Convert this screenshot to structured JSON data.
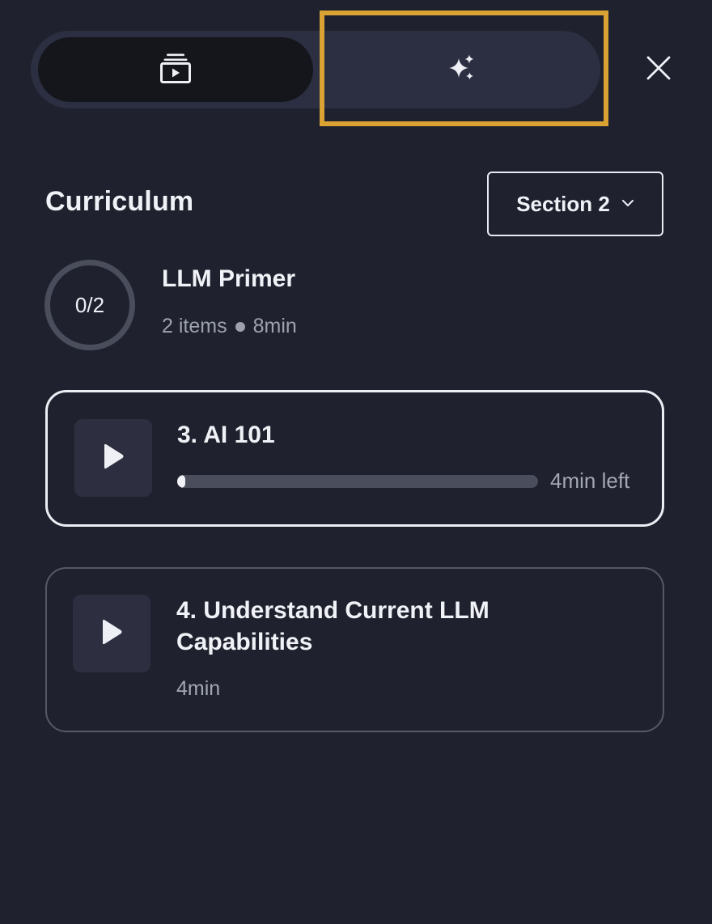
{
  "toggle": {
    "video_icon": "playlist-video-icon",
    "ai_icon": "sparkles-icon",
    "close_icon": "close-icon",
    "focus_color": "#d9a232"
  },
  "header": {
    "title": "Curriculum",
    "section_select": {
      "selected": "Section 2",
      "icon": "chevron-down-icon"
    }
  },
  "section": {
    "progress_text": "0/2",
    "name": "LLM Primer",
    "item_count": "2 items",
    "duration": "8min"
  },
  "lessons": [
    {
      "title": "3. AI 101",
      "progress": 0.02,
      "time_left": "4min left",
      "icon": "play-icon",
      "active": true
    },
    {
      "title": "4. Understand Current LLM Capabilities",
      "duration": "4min",
      "icon": "play-icon",
      "active": false
    }
  ],
  "colors": {
    "background": "#1f222e",
    "text": "#f1f2f7",
    "muted": "#a4a7b4"
  }
}
